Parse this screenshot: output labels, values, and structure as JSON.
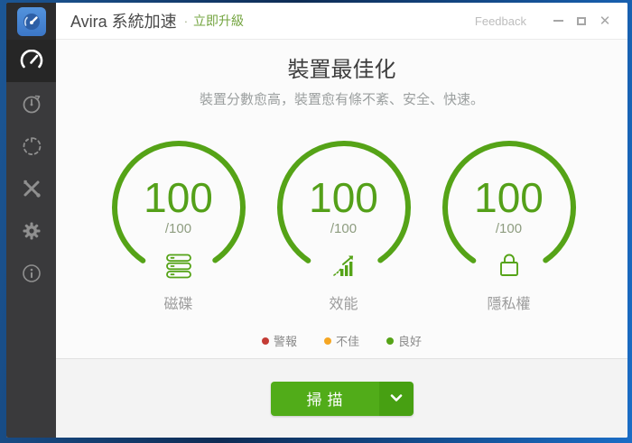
{
  "header": {
    "app_title": "Avira 系統加速",
    "separator": "·",
    "upgrade_link": "立即升級",
    "feedback": "Feedback",
    "close_glyph": "✕"
  },
  "sidebar": {
    "items": [
      {
        "name": "speedometer",
        "active": true
      },
      {
        "name": "timer",
        "active": false
      },
      {
        "name": "boot-optimizer",
        "active": false
      },
      {
        "name": "tools",
        "active": false
      },
      {
        "name": "settings",
        "active": false
      },
      {
        "name": "info",
        "active": false
      }
    ]
  },
  "main": {
    "title": "裝置最佳化",
    "subtitle": "裝置分數愈高，裝置愈有條不紊、安全、快速。"
  },
  "gauges": [
    {
      "score": "100",
      "max": "/100",
      "label": "磁碟",
      "icon": "disk-icon"
    },
    {
      "score": "100",
      "max": "/100",
      "label": "效能",
      "icon": "performance-icon"
    },
    {
      "score": "100",
      "max": "/100",
      "label": "隱私權",
      "icon": "lock-icon"
    }
  ],
  "legend": [
    {
      "label": "警報",
      "color": "#c43c35"
    },
    {
      "label": "不佳",
      "color": "#f5a623"
    },
    {
      "label": "良好",
      "color": "#55a317"
    }
  ],
  "footer": {
    "scan_button": "掃描"
  },
  "colors": {
    "accent_green": "#55a317",
    "button_green": "#51ac19",
    "button_drop_green": "#47a012",
    "sidebar_bg": "#3a3a3c",
    "frame_blue_dark": "#0e2c55",
    "frame_blue_bright": "#1a6dc6"
  }
}
